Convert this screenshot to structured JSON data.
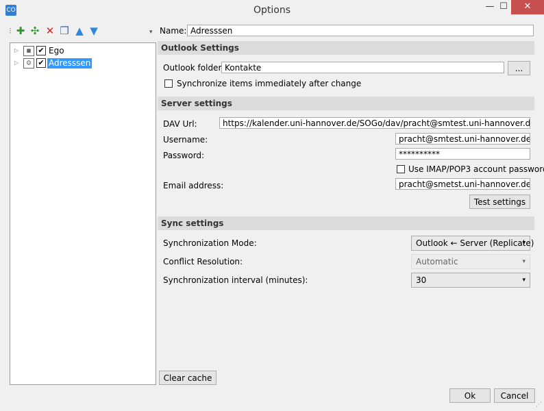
{
  "window": {
    "title": "Options",
    "minimize": "—",
    "maximize": "☐",
    "close": "✕",
    "app_icon": "CO"
  },
  "toolbar": {
    "add": "✚",
    "add_multiple": "✣",
    "delete": "✕",
    "copy": "❐",
    "up": "▲",
    "down": "▼",
    "more": "▾"
  },
  "tree": {
    "items": [
      {
        "label": "Ego",
        "checked": "✔",
        "icon": "calendar-icon"
      },
      {
        "label": "Adresssen",
        "checked": "✔",
        "icon": "contacts-icon"
      }
    ],
    "expander": "▷"
  },
  "profile": {
    "name_label": "Name:",
    "name_value": "Adresssen"
  },
  "outlook": {
    "section": "Outlook Settings",
    "folder_label": "Outlook folder:",
    "folder_value": "Kontakte",
    "browse_label": "...",
    "sync_immediately_label": "Synchronize items immediately after change"
  },
  "server": {
    "section": "Server settings",
    "dav_label": "DAV Url:",
    "dav_value": "https://kalender.uni-hannover.de/SOGo/dav/pracht@smtest.uni-hannover.de/Contacts/p",
    "username_label": "Username:",
    "username_value": "pracht@smtest.uni-hannover.de",
    "password_label": "Password:",
    "password_value": "**********",
    "imap_label": "Use IMAP/POP3 account password",
    "email_label": "Email address:",
    "email_value": "pracht@smetst.uni-hannover.de",
    "test_label": "Test settings"
  },
  "sync": {
    "section": "Sync settings",
    "mode_label": "Synchronization Mode:",
    "mode_value": "Outlook ← Server (Replicate)",
    "conflict_label": "Conflict Resolution:",
    "conflict_value": "Automatic",
    "interval_label": "Synchronization interval (minutes):",
    "interval_value": "30",
    "arrow": "▾"
  },
  "footer": {
    "clear_cache": "Clear cache",
    "ok": "Ok",
    "cancel": "Cancel"
  },
  "colors": {
    "selection": "#3399ff",
    "close_button": "#c74f4f",
    "section_bg": "#dcdcdc"
  }
}
